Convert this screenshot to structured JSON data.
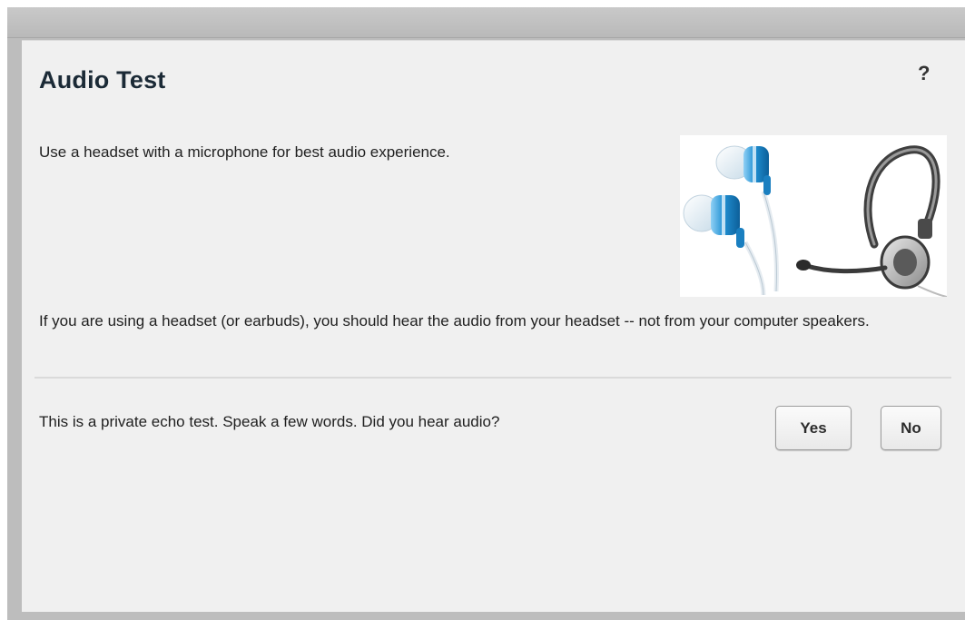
{
  "dialog": {
    "title": "Audio Test",
    "help_label": "?",
    "intro_text": "Use a headset with a microphone for best audio experience.",
    "hint_text": "If you are using a headset (or earbuds), you should hear the audio from your headset -- not from your computer speakers.",
    "echo_text": "This is a private echo test.  Speak a few words.  Did you hear audio?",
    "yes_label": "Yes",
    "no_label": "No",
    "illustration_icons": [
      "earbuds-icon",
      "headset-icon"
    ]
  },
  "colors": {
    "frame_gray": "#bdbdbd",
    "dialog_background": "#f0f0f0",
    "title_text": "#1b2a36",
    "earbud_blue": "#1f8fd2"
  }
}
